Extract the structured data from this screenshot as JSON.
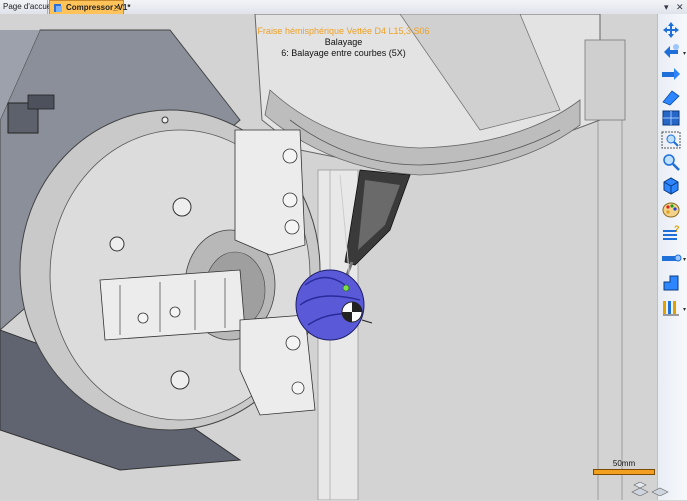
{
  "tabs": [
    {
      "label": "Page d'accueil",
      "active": false
    },
    {
      "label": "Compressor_V1*",
      "active": true
    }
  ],
  "window_controls": {
    "pin": "▾",
    "close": "✕"
  },
  "tool_info": {
    "tool_name": "Fraise hémisphérique Vettée D4 L15,3 S06",
    "operation": "Balayage",
    "step": "6: Balayage entre courbes (5X)"
  },
  "scale_bar": {
    "label": "50mm"
  },
  "colors": {
    "tool_text": "#f0a020",
    "tab_active": "#ffc35a",
    "scale": "#f3a020",
    "part": "#5a5ad8"
  },
  "toolbar_buttons": [
    {
      "name": "pan-view-icon"
    },
    {
      "name": "move-view-icon"
    },
    {
      "name": "rotate-x-icon"
    },
    {
      "name": "rotate-y-icon"
    },
    {
      "name": "plane-view-icon"
    },
    {
      "name": "zoom-window-icon"
    },
    {
      "name": "zoom-icon"
    },
    {
      "name": "solid-view-icon"
    },
    {
      "name": "color-palette-icon"
    },
    {
      "name": "help-layers-icon"
    },
    {
      "name": "measure-icon"
    },
    {
      "name": "machine-icon"
    },
    {
      "name": "tool-path-icon"
    }
  ]
}
